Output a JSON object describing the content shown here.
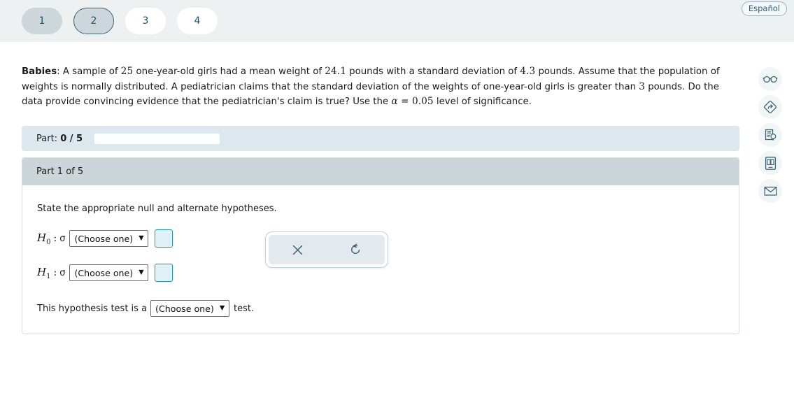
{
  "header": {
    "tabs": [
      {
        "label": "1",
        "state": "visited"
      },
      {
        "label": "2",
        "state": "current"
      },
      {
        "label": "3",
        "state": "unvisited"
      },
      {
        "label": "4",
        "state": "unvisited"
      }
    ],
    "language_button": "Español"
  },
  "question": {
    "title": "Babies",
    "title_suffix": ": A sample of ",
    "sample_size": "25",
    "seg2": " one-year-old girls had a mean weight of ",
    "mean_weight": "24.1",
    "seg3": " pounds with a standard deviation of ",
    "std_dev": "4.3",
    "seg4": " pounds. Assume that the population of weights is normally distributed. A pediatrician claims that the standard deviation of the weights of one-year-old girls is greater than ",
    "claim_value": "3",
    "seg5": " pounds. Do the data provide convincing evidence that the pediatrician's claim is true? Use the ",
    "alpha_symbol": "α",
    "alpha_equals": " = ",
    "alpha_value": "0.05",
    "seg6": " level of significance."
  },
  "progress": {
    "label_prefix": "Part: ",
    "completed": "0",
    "separator": " / ",
    "total": "5",
    "percent": "0%"
  },
  "part_panel": {
    "header": "Part 1 of 5",
    "prompt": "State the appropriate null and alternate hypotheses.",
    "hypotheses": [
      {
        "name": "H",
        "subscript": "0",
        "colon": ":",
        "parameter": "σ",
        "select_value": "(Choose one)",
        "caret": "▼",
        "answer_value": ""
      },
      {
        "name": "H",
        "subscript": "1",
        "colon": ":",
        "parameter": "σ",
        "select_value": "(Choose one)",
        "caret": "▼",
        "answer_value": ""
      }
    ],
    "test_type": {
      "text_before": "This hypothesis test is a",
      "select_value": "(Choose one)",
      "caret": "▼",
      "text_after": "test."
    }
  },
  "action_popup": {
    "clear_icon": "close-x-icon",
    "reset_icon": "undo-rotate-icon"
  },
  "right_rail": [
    {
      "icon": "glasses-icon"
    },
    {
      "icon": "diamond-arrow-icon"
    },
    {
      "icon": "hint-document-icon"
    },
    {
      "icon": "ebook-icon"
    },
    {
      "icon": "mail-envelope-icon"
    }
  ],
  "colors": {
    "header_band": "#eef1f2",
    "tab_active": "#cdd7db",
    "progress_bar_bg": "#dde7ee",
    "panel_header": "#ccd6d9",
    "answer_box_border": "#2196b4",
    "answer_box_fill": "#e0f2f7",
    "icon_blue": "#3c6578"
  }
}
